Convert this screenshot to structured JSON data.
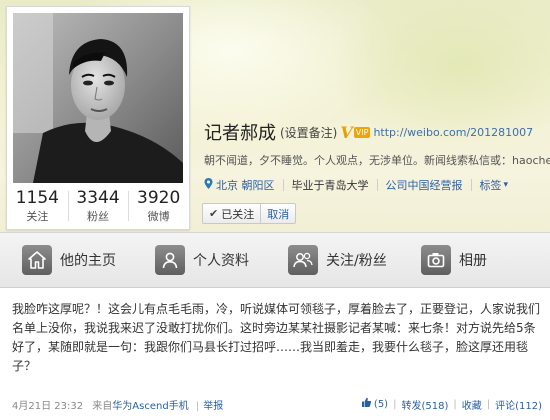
{
  "profile": {
    "name": "记者郝成",
    "remark_link": "(设置备注)",
    "verified_mark": "V",
    "vip_badge": "VIP",
    "url": "http://weibo.com/201281007",
    "bio": "朝不闻道，夕不睡觉。个人观点，无涉单位。新闻线索私信或：haochen",
    "location": "北京 朝阳区",
    "school": "毕业于青岛大学",
    "company": "公司中国经营报",
    "tags_label": "标签",
    "tags_chevron": "▾",
    "location_icon": "location-pin-icon"
  },
  "stats": [
    {
      "value": "1154",
      "label": "关注"
    },
    {
      "value": "3344",
      "label": "粉丝"
    },
    {
      "value": "3920",
      "label": "微博"
    }
  ],
  "follow": {
    "state_label": "已关注",
    "divider": "|",
    "unfollow_label": "取消"
  },
  "tabs": [
    {
      "label": "他的主页",
      "icon": "home-icon"
    },
    {
      "label": "个人资料",
      "icon": "person-icon"
    },
    {
      "label": "关注/粉丝",
      "icon": "users-icon"
    },
    {
      "label": "相册",
      "icon": "camera-icon"
    }
  ],
  "post": {
    "text": "我脸咋这厚呢？！这会儿有点毛毛雨，冷，听说媒体可领毯子，厚着脸去了，正要登记，人家说我们名单上没你，我说我来迟了没敢打扰你们。这时旁边某某社摄影记者某喊：来七条！对方说先给5条好了，某随即就是一句：我跟你们马县长打过招呼……我当即羞走，我要什么毯子，脸这厚还用毯子？",
    "time": "4月21日 23:32",
    "source_prefix": "来自",
    "source": "华为Ascend手机",
    "report": "举报",
    "like_count": "(5)",
    "repost": "转发(518)",
    "favorite": "收藏",
    "comment": "评论(112)"
  },
  "colors": {
    "link": "#2b5fa6",
    "verified": "#e8a100",
    "cover": "#f3f1d4"
  }
}
